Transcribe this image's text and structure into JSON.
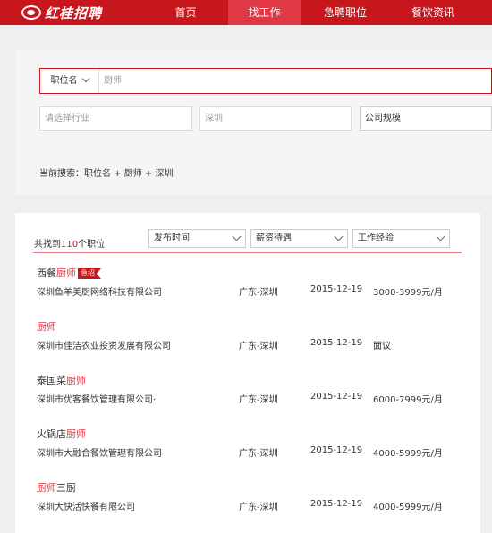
{
  "header": {
    "logo_text": "红桂招聘",
    "nav": [
      {
        "label": "首页",
        "active": false
      },
      {
        "label": "找工作",
        "active": true
      },
      {
        "label": "急聘职位",
        "active": false
      },
      {
        "label": "餐饮资讯",
        "active": false
      }
    ]
  },
  "search": {
    "keyword_type": "职位名",
    "keyword_placeholder": "厨师",
    "industry_placeholder": "请选择行业",
    "city": "深圳",
    "company_size": "公司规模",
    "current_label": "当前搜索：",
    "current_terms": "职位名 + 厨师 + 深圳"
  },
  "results": {
    "count_prefix": "共找到",
    "count": "110",
    "count_suffix": "个职位",
    "filters": [
      "发布时间",
      "薪资待遇",
      "工作经验"
    ],
    "jobs": [
      {
        "title_pre": "西餐",
        "title_hl": "厨师",
        "title_post": "",
        "urgent": "急招",
        "company": "深圳鱼羊美厨网络科技有限公司",
        "location": "广东-深圳",
        "date": "2015-12-19",
        "salary": "3000-3999元/月"
      },
      {
        "title_pre": "",
        "title_hl": "厨师",
        "title_post": "",
        "urgent": "",
        "company": "深圳市佳洁农业投资发展有限公司",
        "location": "广东-深圳",
        "date": "2015-12-19",
        "salary": "面议"
      },
      {
        "title_pre": "泰国菜",
        "title_hl": "厨师",
        "title_post": "",
        "urgent": "",
        "company": "深圳市优客餐饮管理有限公司·",
        "location": "广东-深圳",
        "date": "2015-12-19",
        "salary": "6000-7999元/月"
      },
      {
        "title_pre": "火锅店",
        "title_hl": "厨师",
        "title_post": "",
        "urgent": "",
        "company": "深圳市大融合餐饮管理有限公司",
        "location": "广东-深圳",
        "date": "2015-12-19",
        "salary": "4000-5999元/月"
      },
      {
        "title_pre": "",
        "title_hl": "厨师",
        "title_post": "三厨",
        "urgent": "",
        "company": "深圳大快活快餐有限公司",
        "location": "广东-深圳",
        "date": "2015-12-19",
        "salary": "4000-5999元/月"
      }
    ]
  }
}
